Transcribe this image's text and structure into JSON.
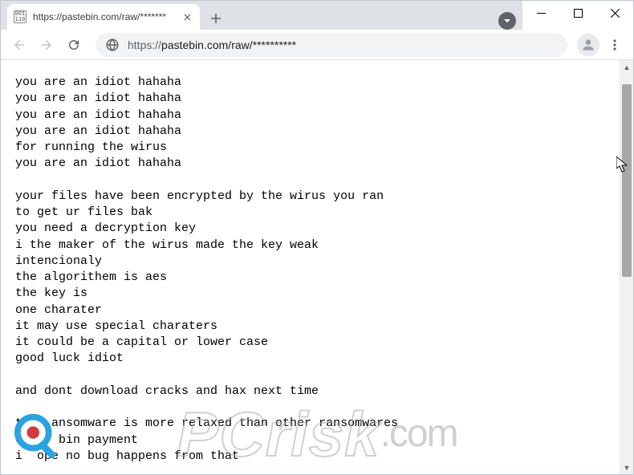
{
  "window": {
    "tab_title": "https://pastebin.com/raw/*******",
    "url_proto": "https://",
    "url_rest": "pastebin.com/raw/**********"
  },
  "page_text": "you are an idiot hahaha\nyou are an idiot hahaha\nyou are an idiot hahaha\nyou are an idiot hahaha\nfor running the wirus\nyou are an idiot hahaha\n\nyour files have been encrypted by the wirus you ran\nto get ur files bak\nyou need a decryption key\ni the maker of the wirus made the key weak\nintencionaly\nthe algorithem is aes\nthe key is\none charater\nit may use special charaters\nit could be a capital or lower case\ngood luck idiot\n\nand dont download cracks and hax next time\n\nt    ansomware is more relaxed than other ransomwares\n0     bin payment\ni  ope no bug happens from that",
  "watermark": {
    "main": "PCrisk",
    "suffix": ".com"
  }
}
